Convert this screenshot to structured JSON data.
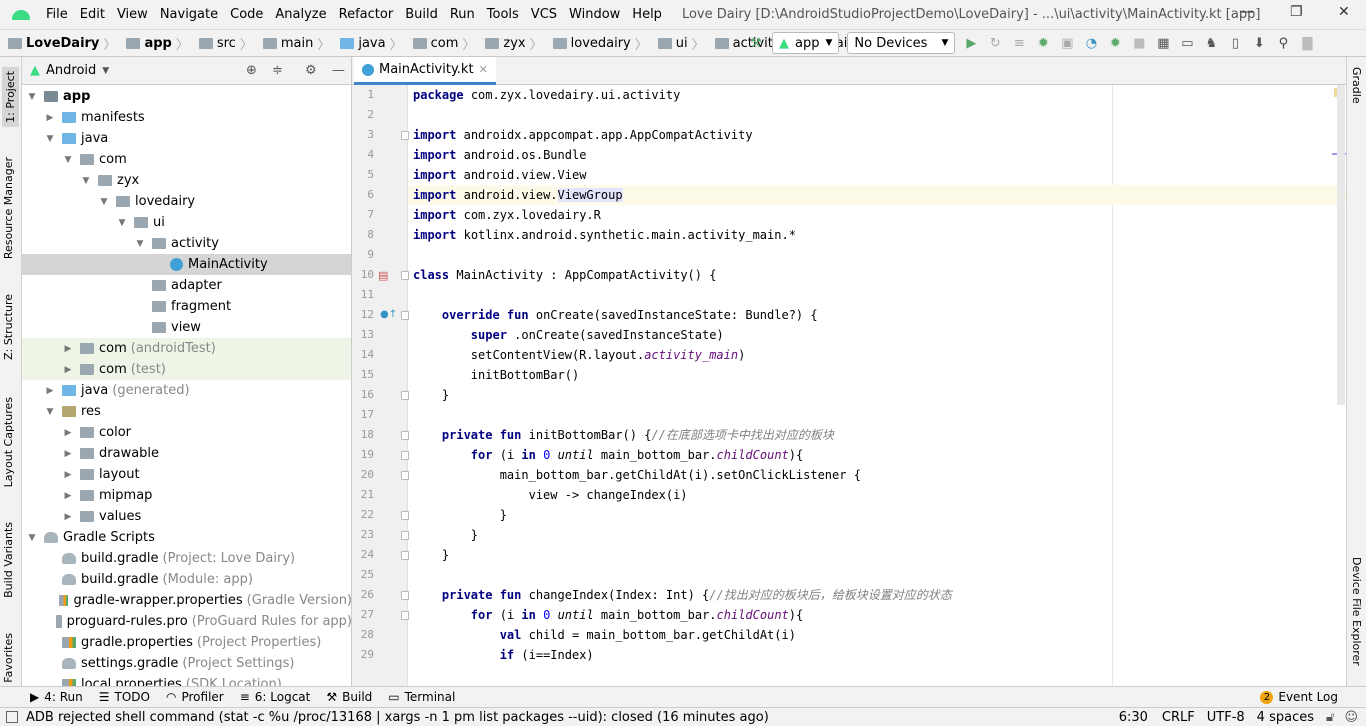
{
  "menu": {
    "items": [
      "File",
      "Edit",
      "View",
      "Navigate",
      "Code",
      "Analyze",
      "Refactor",
      "Build",
      "Run",
      "Tools",
      "VCS",
      "Window",
      "Help"
    ],
    "title": "Love Dairy [D:\\AndroidStudioProjectDemo\\LoveDairy] - ...\\ui\\activity\\MainActivity.kt [app]"
  },
  "breadcrumb": [
    "LoveDairy",
    "app",
    "src",
    "main",
    "java",
    "com",
    "zyx",
    "lovedairy",
    "ui",
    "activity",
    "MainActivity"
  ],
  "toolbar": {
    "config": "app",
    "device": "No Devices"
  },
  "left_tabs": [
    "1: Project",
    "Resource Manager",
    "Z: Structure",
    "Layout Captures",
    "Build Variants",
    "Favorites"
  ],
  "right_tabs": [
    "Gradle",
    "Device File Explorer"
  ],
  "project": {
    "view": "Android",
    "rows": [
      {
        "label": "app",
        "depth": 0,
        "open": true,
        "icon": "app",
        "bold": true
      },
      {
        "label": "manifests",
        "depth": 1,
        "open": false,
        "icon": "java"
      },
      {
        "label": "java",
        "depth": 1,
        "open": true,
        "icon": "java"
      },
      {
        "label": "com",
        "depth": 2,
        "open": true,
        "icon": "pkg"
      },
      {
        "label": "zyx",
        "depth": 3,
        "open": true,
        "icon": "pkg"
      },
      {
        "label": "lovedairy",
        "depth": 4,
        "open": true,
        "icon": "pkg"
      },
      {
        "label": "ui",
        "depth": 5,
        "open": true,
        "icon": "pkg"
      },
      {
        "label": "activity",
        "depth": 6,
        "open": true,
        "icon": "pkg"
      },
      {
        "label": "MainActivity",
        "depth": 7,
        "icon": "kt",
        "selected": true
      },
      {
        "label": "adapter",
        "depth": 6,
        "icon": "pkg"
      },
      {
        "label": "fragment",
        "depth": 6,
        "icon": "pkg"
      },
      {
        "label": "view",
        "depth": 6,
        "icon": "pkg"
      },
      {
        "label": "com",
        "hint": "(androidTest)",
        "depth": 2,
        "open": false,
        "icon": "pkg",
        "test": true
      },
      {
        "label": "com",
        "hint": "(test)",
        "depth": 2,
        "open": false,
        "icon": "pkg",
        "test": true
      },
      {
        "label": "java",
        "hint": "(generated)",
        "depth": 1,
        "open": false,
        "icon": "java"
      },
      {
        "label": "res",
        "depth": 1,
        "open": true,
        "icon": "res"
      },
      {
        "label": "color",
        "depth": 2,
        "open": false,
        "icon": "pkg"
      },
      {
        "label": "drawable",
        "depth": 2,
        "open": false,
        "icon": "pkg"
      },
      {
        "label": "layout",
        "depth": 2,
        "open": false,
        "icon": "pkg"
      },
      {
        "label": "mipmap",
        "depth": 2,
        "open": false,
        "icon": "pkg"
      },
      {
        "label": "values",
        "depth": 2,
        "open": false,
        "icon": "pkg"
      },
      {
        "label": "Gradle Scripts",
        "depth": 0,
        "open": true,
        "icon": "gr"
      },
      {
        "label": "build.gradle",
        "hint": "(Project: Love Dairy)",
        "depth": 1,
        "icon": "gr"
      },
      {
        "label": "build.gradle",
        "hint": "(Module: app)",
        "depth": 1,
        "icon": "gr"
      },
      {
        "label": "gradle-wrapper.properties",
        "hint": "(Gradle Version)",
        "depth": 1,
        "icon": "props"
      },
      {
        "label": "proguard-rules.pro",
        "hint": "(ProGuard Rules for app)",
        "depth": 1,
        "icon": "file"
      },
      {
        "label": "gradle.properties",
        "hint": "(Project Properties)",
        "depth": 1,
        "icon": "props"
      },
      {
        "label": "settings.gradle",
        "hint": "(Project Settings)",
        "depth": 1,
        "icon": "gr"
      },
      {
        "label": "local.properties",
        "hint": "(SDK Location)",
        "depth": 1,
        "icon": "props"
      }
    ]
  },
  "editor": {
    "tab": "MainActivity.kt",
    "current_line": 6,
    "lines": [
      [
        [
          "k",
          "package"
        ],
        [
          "",
          "com.zyx.lovedairy.ui.activity"
        ]
      ],
      [],
      [
        [
          "k",
          "import"
        ],
        [
          "",
          "androidx.appcompat.app.AppCompatActivity"
        ]
      ],
      [
        [
          "k",
          "import"
        ],
        [
          "",
          "android.os.Bundle"
        ]
      ],
      [
        [
          "k",
          "import"
        ],
        [
          "",
          "android.view.View"
        ]
      ],
      [
        [
          "k",
          "import"
        ],
        [
          "",
          "android.view."
        ],
        [
          "hl",
          "ViewGroup"
        ]
      ],
      [
        [
          "k",
          "import"
        ],
        [
          "",
          "com.zyx.lovedairy.R"
        ]
      ],
      [
        [
          "k",
          "import"
        ],
        [
          "",
          "kotlinx.android.synthetic.main.activity_main.*"
        ]
      ],
      [],
      [
        [
          "k",
          "class"
        ],
        [
          "",
          "MainActivity : AppCompatActivity() {"
        ]
      ],
      [],
      [
        [
          "",
          "    "
        ],
        [
          "k",
          "override fun"
        ],
        [
          "",
          "onCreate(savedInstanceState: Bundle?) {"
        ]
      ],
      [
        [
          "",
          "        "
        ],
        [
          "k",
          "super"
        ],
        [
          "",
          ".onCreate(savedInstanceState)"
        ]
      ],
      [
        [
          "",
          "        setContentView(R.layout."
        ],
        [
          "p",
          "activity_main"
        ],
        [
          "",
          ")"
        ]
      ],
      [
        [
          "",
          "        initBottomBar()"
        ]
      ],
      [
        [
          "",
          "    }"
        ]
      ],
      [],
      [
        [
          "",
          "    "
        ],
        [
          "k",
          "private fun"
        ],
        [
          "",
          "initBottomBar() {"
        ],
        [
          "c",
          "//在底部选项卡中找出对应的板块"
        ]
      ],
      [
        [
          "",
          "        "
        ],
        [
          "k",
          "for"
        ],
        [
          "",
          "(i "
        ],
        [
          "k",
          "in"
        ],
        [
          "n",
          "0"
        ],
        [
          "i",
          "until"
        ],
        [
          "",
          "main_bottom_bar."
        ],
        [
          "p",
          "childCount"
        ],
        [
          "",
          "){"
        ]
      ],
      [
        [
          "",
          "            main_bottom_bar.getChildAt(i).setOnClickListener {"
        ]
      ],
      [
        [
          "",
          "                view -> changeIndex(i)"
        ]
      ],
      [
        [
          "",
          "            }"
        ]
      ],
      [
        [
          "",
          "        }"
        ]
      ],
      [
        [
          "",
          "    }"
        ]
      ],
      [],
      [
        [
          "",
          "    "
        ],
        [
          "k",
          "private fun"
        ],
        [
          "",
          "changeIndex(Index: Int) {"
        ],
        [
          "c",
          "//找出对应的板块后，给板块设置对应的状态"
        ]
      ],
      [
        [
          "",
          "        "
        ],
        [
          "k",
          "for"
        ],
        [
          "",
          "(i "
        ],
        [
          "k",
          "in"
        ],
        [
          "n",
          "0"
        ],
        [
          "i",
          "until"
        ],
        [
          "",
          "main_bottom_bar."
        ],
        [
          "p",
          "childCount"
        ],
        [
          "",
          "){"
        ]
      ],
      [
        [
          "",
          "            "
        ],
        [
          "k",
          "val"
        ],
        [
          "",
          "child = main_bottom_bar.getChildAt(i)"
        ]
      ],
      [
        [
          "",
          "            "
        ],
        [
          "k",
          "if"
        ],
        [
          "",
          "(i==Index)"
        ]
      ]
    ]
  },
  "bottom_tools": [
    "4: Run",
    "TODO",
    "Profiler",
    "6: Logcat",
    "Build",
    "Terminal"
  ],
  "event_log": {
    "count": "2",
    "label": "Event Log"
  },
  "status": {
    "message": "ADB rejected shell command (stat -c %u /proc/13168 | xargs -n 1 pm list packages --uid): closed (16 minutes ago)",
    "position": "6:30",
    "line_sep": "CRLF",
    "encoding": "UTF-8",
    "indent": "4 spaces"
  },
  "colors": {
    "keyword": "#000080",
    "number": "#0000ff",
    "property": "#660e7a",
    "comment": "#808080",
    "accent": "#4083c9",
    "current_line": "#fdfae9"
  }
}
